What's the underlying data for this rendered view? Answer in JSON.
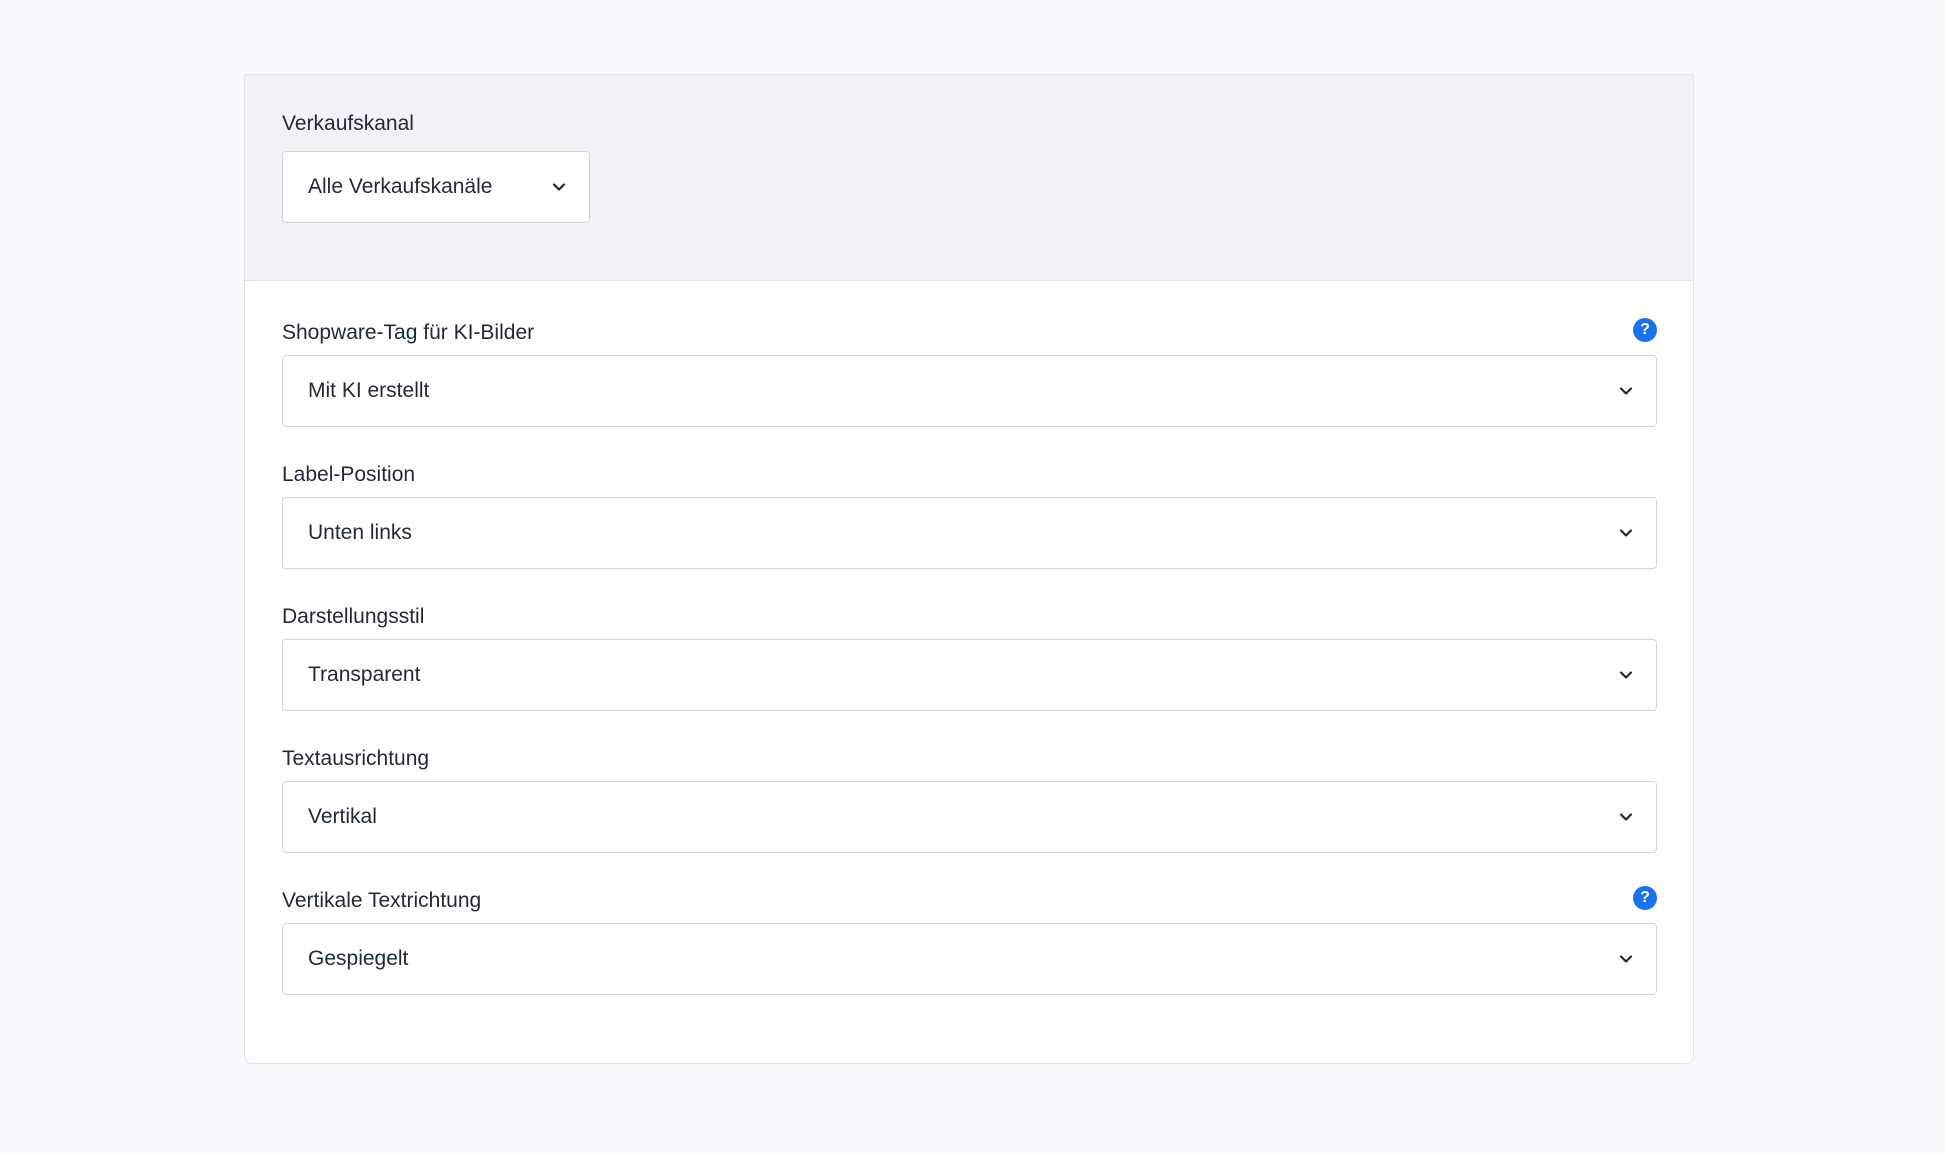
{
  "colors": {
    "page_background": "#f9fafd",
    "header_background": "#f1f2f5",
    "help_icon": "#1a73e8",
    "border": "#cfd5de",
    "text": "#1f2a37"
  },
  "sales_channel": {
    "label": "Verkaufskanal",
    "value": "Alle Verkaufskanäle"
  },
  "fields": [
    {
      "label": "Shopware-Tag für KI-Bilder",
      "value": "Mit KI erstellt",
      "help_icon": "question-mark-icon",
      "help_glyph": "?"
    },
    {
      "label": "Label-Position",
      "value": "Unten links"
    },
    {
      "label": "Darstellungsstil",
      "value": "Transparent"
    },
    {
      "label": "Textausrichtung",
      "value": "Vertikal"
    },
    {
      "label": "Vertikale Textrichtung",
      "value": "Gespiegelt",
      "help_icon": "question-mark-icon",
      "help_glyph": "?"
    }
  ],
  "icons": {
    "dropdown": "chevron-down-icon"
  }
}
